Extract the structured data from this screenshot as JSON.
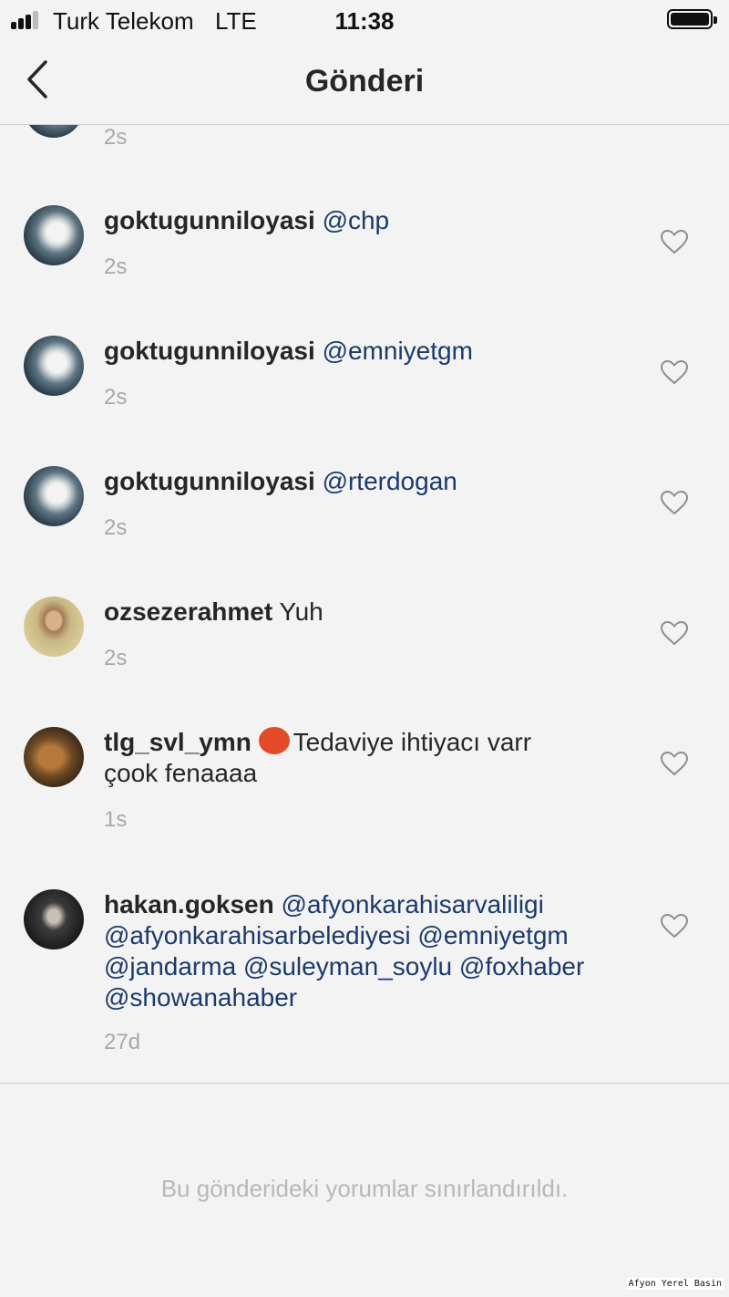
{
  "status_bar": {
    "carrier": "Turk Telekom",
    "network": "LTE",
    "time": "11:38"
  },
  "nav": {
    "title": "Gönderi"
  },
  "comments": [
    {
      "username": "",
      "text": "",
      "age": "2s",
      "avatar": "flower-avatar"
    },
    {
      "username": "goktugunniloyasi",
      "mention": "@chp",
      "age": "2s",
      "avatar": "flower-avatar"
    },
    {
      "username": "goktugunniloyasi",
      "mention": "@emniyetgm",
      "age": "2s",
      "avatar": "flower-avatar"
    },
    {
      "username": "goktugunniloyasi",
      "mention": "@rterdogan",
      "age": "2s",
      "avatar": "flower-avatar"
    },
    {
      "username": "ozsezerahmet",
      "text": "Yuh",
      "age": "2s",
      "avatar": "man-avatar"
    },
    {
      "username": "tlg_svl_ymn",
      "emoji": "angry-face-emoji",
      "text_line1": "Tedaviye ihtiyacı varr",
      "text_line2": "çook fenaaaa",
      "age": "1s",
      "avatar": "cat-avatar"
    },
    {
      "username": "hakan.goksen",
      "mentions": [
        "@afyonkarahisarvaliligi",
        "@afyonkarahisarbelediyesi",
        "@emniyetgm",
        "@jandarma",
        "@suleyman_soylu",
        "@foxhaber",
        "@showanahaber"
      ],
      "age": "27d",
      "avatar": "man-avatar"
    }
  ],
  "footer": {
    "note": "Bu gönderideki yorumlar sınırlandırıldı."
  },
  "watermark": "Afyon Yerel Basin",
  "colors": {
    "background": "#f3f3f3",
    "mention": "#1b3a6b",
    "muted": "#a8a8a8"
  }
}
